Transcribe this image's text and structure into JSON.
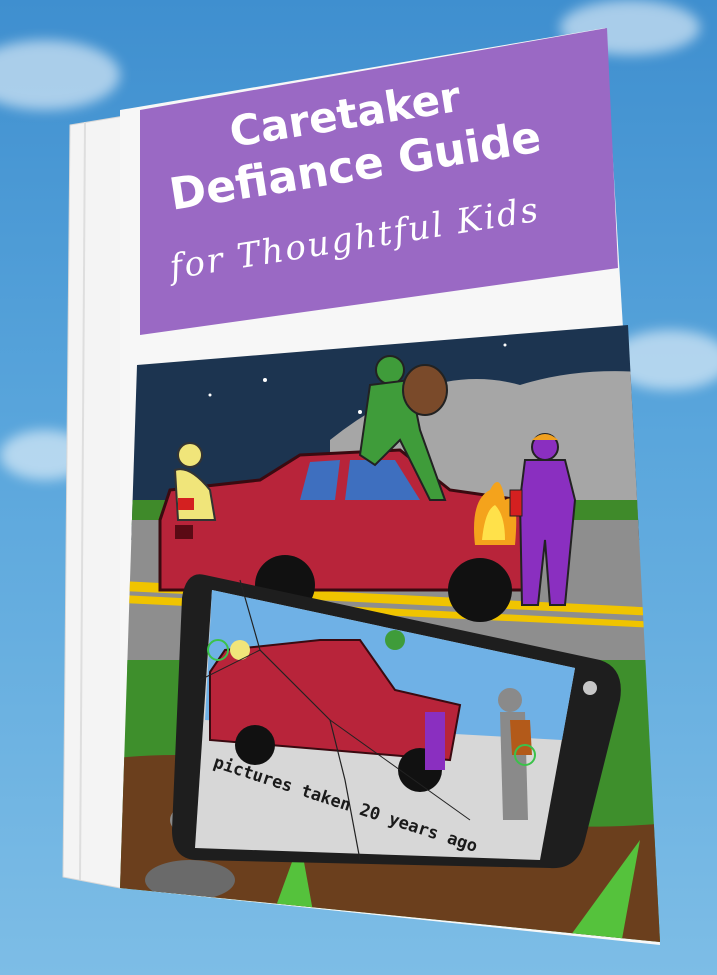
{
  "book": {
    "title_line1": "Caretaker",
    "title_line2": "Defiance Guide",
    "subtitle": "for Thoughtful Kids"
  },
  "phone": {
    "caption": "pictures taken 20 years ago"
  },
  "colors": {
    "sky": "#5aa6dc",
    "title_band": "#9a69c4",
    "car": "#b8243a",
    "night_sky": "#1c3450",
    "phone_body": "#1e1e1e",
    "spine": "#f2f2f2"
  },
  "icons": {
    "title_bg": "purple-title-banner",
    "medic": "medic-figure-icon",
    "climber": "climbing-figure-icon",
    "firefighter": "firefighter-figure-icon",
    "fire": "fire-icon",
    "car": "crashed-car-icon",
    "phone": "cracked-phone-icon"
  }
}
